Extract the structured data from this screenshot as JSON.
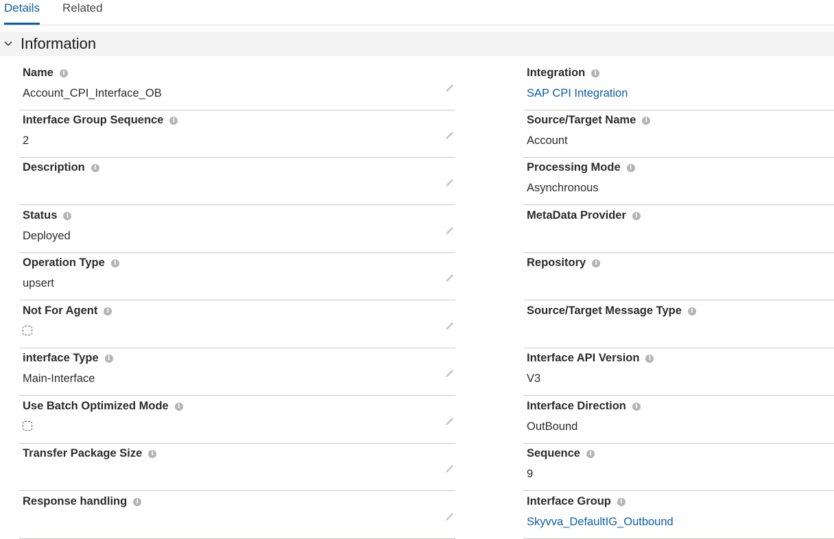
{
  "tabs": [
    {
      "label": "Details",
      "active": true
    },
    {
      "label": "Related",
      "active": false
    }
  ],
  "section": {
    "title": "Information",
    "expanded": true
  },
  "left_fields": [
    {
      "label": "Name",
      "value": "Account_CPI_Interface_OB",
      "type": "text"
    },
    {
      "label": "Interface Group Sequence",
      "value": "2",
      "type": "text"
    },
    {
      "label": "Description",
      "value": "",
      "type": "text"
    },
    {
      "label": "Status",
      "value": "Deployed",
      "type": "text"
    },
    {
      "label": "Operation Type",
      "value": "upsert",
      "type": "text"
    },
    {
      "label": "Not For Agent",
      "value": "",
      "type": "checkbox",
      "checked": false
    },
    {
      "label": "interface Type",
      "value": "Main-Interface",
      "type": "text"
    },
    {
      "label": "Use Batch Optimized Mode",
      "value": "",
      "type": "checkbox",
      "checked": false
    },
    {
      "label": "Transfer Package Size",
      "value": "",
      "type": "text"
    },
    {
      "label": "Response handling",
      "value": "",
      "type": "text"
    }
  ],
  "right_fields": [
    {
      "label": "Integration",
      "value": "SAP CPI Integration",
      "type": "link"
    },
    {
      "label": "Source/Target Name",
      "value": "Account",
      "type": "text"
    },
    {
      "label": "Processing Mode",
      "value": "Asynchronous",
      "type": "text"
    },
    {
      "label": "MetaData Provider",
      "value": "",
      "type": "text"
    },
    {
      "label": "Repository",
      "value": "",
      "type": "text"
    },
    {
      "label": "Source/Target Message Type",
      "value": "",
      "type": "text"
    },
    {
      "label": "Interface API Version",
      "value": "V3",
      "type": "text"
    },
    {
      "label": "Interface Direction",
      "value": "OutBound",
      "type": "text"
    },
    {
      "label": "Sequence",
      "value": "9",
      "type": "text"
    },
    {
      "label": "Interface Group",
      "value": "Skyvva_DefaultIG_Outbound",
      "type": "link"
    }
  ],
  "icons": {
    "info": "info-icon",
    "edit": "pencil-icon",
    "chevron": "chevron-down-icon"
  },
  "colors": {
    "link": "#0b5cab",
    "active_tab": "#0b5cab",
    "section_bg": "#f3f3f3"
  }
}
